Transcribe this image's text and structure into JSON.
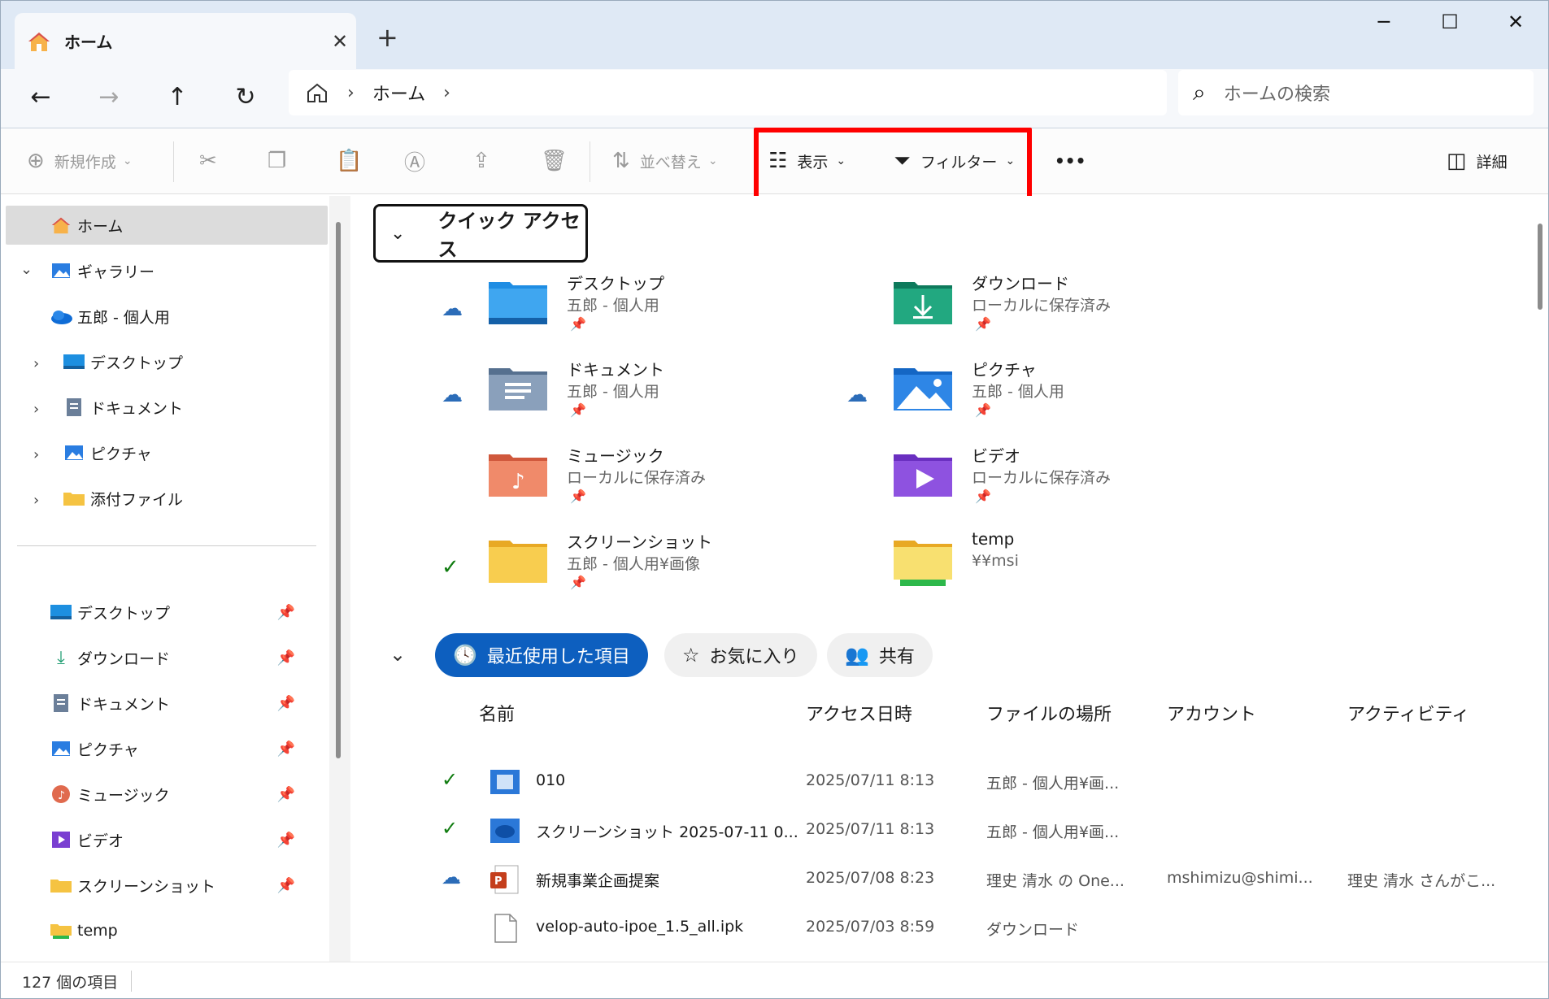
{
  "tab": {
    "title": "ホーム",
    "close": "✕",
    "new_tab": "+"
  },
  "window_controls": {
    "minimize": "─",
    "maximize": "☐",
    "close": "✕"
  },
  "nav": {
    "back": "←",
    "forward": "→",
    "up": "↑",
    "refresh": "↻",
    "breadcrumb": [
      "ホーム"
    ],
    "search_placeholder": "ホームの検索"
  },
  "toolbar": {
    "new": "新規作成",
    "sort": "並べ替え",
    "view": "表示",
    "filter": "フィルター",
    "more": "•••",
    "details": "詳細"
  },
  "sidebar": {
    "home": "ホーム",
    "gallery": "ギャラリー",
    "onedrive": "五郎 - 個人用",
    "onedrive_children": [
      "デスクトップ",
      "ドキュメント",
      "ピクチャ",
      "添付ファイル"
    ],
    "pinned": [
      "デスクトップ",
      "ダウンロード",
      "ドキュメント",
      "ピクチャ",
      "ミュージック",
      "ビデオ",
      "スクリーンショット",
      "temp"
    ]
  },
  "quick_access": {
    "title": "クイック アクセス",
    "folders": [
      {
        "name": "デスクトップ",
        "sub": "五郎 - 個人用",
        "status": "cloud"
      },
      {
        "name": "ダウンロード",
        "sub": "ローカルに保存済み",
        "status": "none"
      },
      {
        "name": "ドキュメント",
        "sub": "五郎 - 個人用",
        "status": "cloud"
      },
      {
        "name": "ピクチャ",
        "sub": "五郎 - 個人用",
        "status": "cloud"
      },
      {
        "name": "ミュージック",
        "sub": "ローカルに保存済み",
        "status": "none"
      },
      {
        "name": "ビデオ",
        "sub": "ローカルに保存済み",
        "status": "none"
      },
      {
        "name": "スクリーンショット",
        "sub": "五郎 - 個人用¥画像",
        "status": "ok"
      },
      {
        "name": "temp",
        "sub": "¥¥msi",
        "status": "none"
      }
    ]
  },
  "recent": {
    "tabs": [
      "最近使用した項目",
      "お気に入り",
      "共有"
    ],
    "columns": [
      "名前",
      "アクセス日時",
      "ファイルの場所",
      "アカウント",
      "アクティビティ"
    ],
    "rows": [
      {
        "name": "010",
        "date": "2025/07/11 8:13",
        "location": "五郎 - 個人用¥画...",
        "account": "",
        "activity": "",
        "status": "ok"
      },
      {
        "name": "スクリーンショット 2025-07-11 0...",
        "date": "2025/07/11 8:13",
        "location": "五郎 - 個人用¥画...",
        "account": "",
        "activity": "",
        "status": "ok"
      },
      {
        "name": "新規事業企画提案",
        "date": "2025/07/08 8:23",
        "location": "理史 清水 の One...",
        "account": "mshimizu@shimi...",
        "activity": "理史 清水 さんがこ...",
        "status": "cloud"
      },
      {
        "name": "velop-auto-ipoe_1.5_all.ipk",
        "date": "2025/07/03 8:59",
        "location": "ダウンロード",
        "account": "",
        "activity": "",
        "status": "none"
      }
    ]
  },
  "statusbar": {
    "count": "127 個の項目"
  },
  "colors": {
    "accent": "#0d5fbf",
    "highlight": "#ff0000",
    "ok": "#107c10",
    "cloud": "#2b6cb8"
  }
}
